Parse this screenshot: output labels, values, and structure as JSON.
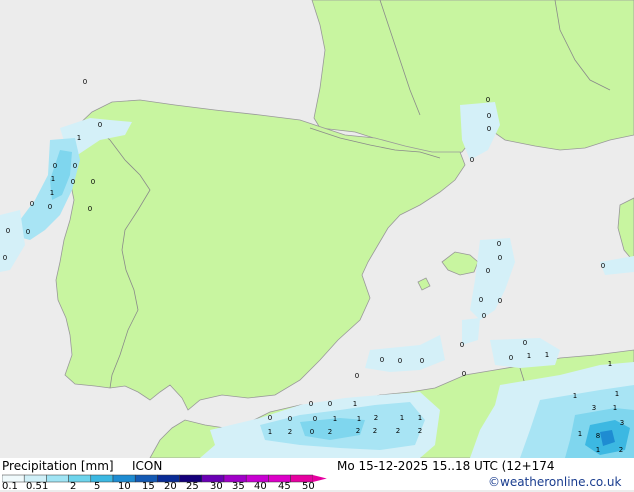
{
  "map": {
    "colors": {
      "sea": "#ececec",
      "land": "#c8f5a0",
      "border": "#8a8a8a",
      "coast": "#999999"
    },
    "precip_values": [
      "0",
      "0",
      "1",
      "0",
      "0",
      "1",
      "0",
      "0",
      "1",
      "0",
      "0",
      "0",
      "0",
      "0",
      "0",
      "0",
      "0",
      "0",
      "0",
      "0",
      "0",
      "0",
      "0",
      "0",
      "0",
      "0",
      "0",
      "0",
      "0",
      "1",
      "1",
      "0",
      "0",
      "0",
      "0",
      "0",
      "0",
      "0",
      "1",
      "0",
      "0",
      "0",
      "1",
      "1",
      "2",
      "1",
      "1",
      "1",
      "2",
      "0",
      "2",
      "2",
      "2",
      "2",
      "2",
      "1",
      "1",
      "3",
      "1",
      "8",
      "1",
      "1",
      "3",
      "1",
      "2"
    ]
  },
  "footer": {
    "title": "Precipitation [mm]",
    "model": "ICON",
    "validity": "Mo 15-12-2025 15..18 UTC (12+174",
    "credit": "©weatheronline.co.uk",
    "legend": {
      "ticks": [
        "0.1",
        "0.5",
        "1",
        "2",
        "5",
        "10",
        "15",
        "20",
        "25",
        "30",
        "35",
        "40",
        "45",
        "50"
      ],
      "colors": [
        "#f0fafc",
        "#d0f0f8",
        "#a0e4f4",
        "#6ed4ec",
        "#3cb8e2",
        "#1e8cd2",
        "#145ab4",
        "#0a2c96",
        "#14007a",
        "#6a00b4",
        "#a000c8",
        "#c800d2",
        "#dc00c8",
        "#e600a0"
      ]
    }
  }
}
